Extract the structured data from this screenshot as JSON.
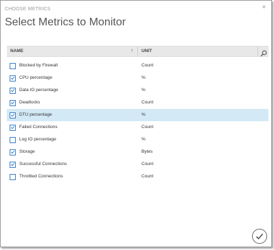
{
  "dialog": {
    "section_label": "CHOOSE METRICS",
    "title": "Select Metrics to Monitor"
  },
  "table": {
    "columns": {
      "name": "NAME",
      "unit": "UNIT"
    },
    "sort_icon": "sort-up-arrow-icon",
    "search_icon": "search-icon",
    "rows": [
      {
        "name": "Blocked by Firewall",
        "unit": "Count",
        "checked": false,
        "selected": false
      },
      {
        "name": "CPU percentage",
        "unit": "%",
        "checked": true,
        "selected": false
      },
      {
        "name": "Data IO percentage",
        "unit": "%",
        "checked": true,
        "selected": false
      },
      {
        "name": "Deadlocks",
        "unit": "Count",
        "checked": true,
        "selected": false
      },
      {
        "name": "DTU percentage",
        "unit": "%",
        "checked": true,
        "selected": true
      },
      {
        "name": "Failed Connections",
        "unit": "Count",
        "checked": true,
        "selected": false
      },
      {
        "name": "Log IO percentage",
        "unit": "%",
        "checked": false,
        "selected": false
      },
      {
        "name": "Storage",
        "unit": "Bytes",
        "checked": true,
        "selected": false
      },
      {
        "name": "Successful Connections",
        "unit": "Count",
        "checked": true,
        "selected": false
      },
      {
        "name": "Throttled Connections",
        "unit": "Count",
        "checked": false,
        "selected": false
      }
    ]
  },
  "footer": {
    "ok_icon": "checkmark-circle-icon"
  },
  "colors": {
    "accent": "#3b7fc4",
    "selected_row": "#d3e9f6",
    "header_bg": "#e8e8e8"
  }
}
